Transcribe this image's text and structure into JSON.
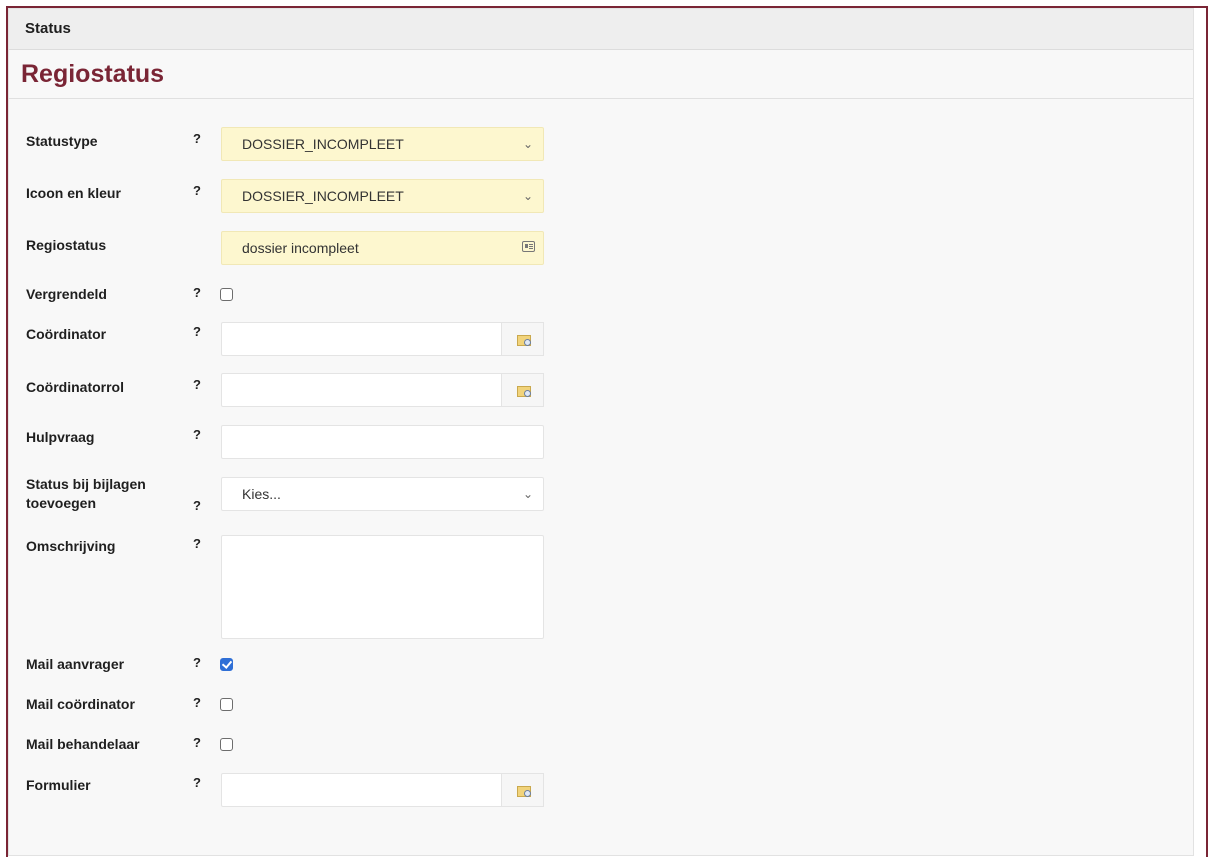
{
  "panel": {
    "header": "Status",
    "title": "Regiostatus"
  },
  "fields": {
    "statustype": {
      "label": "Statustype",
      "help": "?",
      "value": "DOSSIER_INCOMPLEET"
    },
    "icoon": {
      "label": "Icoon en kleur",
      "help": "?",
      "value": "DOSSIER_INCOMPLEET"
    },
    "regiostatus": {
      "label": "Regiostatus",
      "value": "dossier incompleet"
    },
    "vergrendeld": {
      "label": "Vergrendeld",
      "help": "?",
      "checked": false
    },
    "coordinator": {
      "label": "Coördinator",
      "help": "?",
      "value": ""
    },
    "coordinatorrol": {
      "label": "Coördinatorrol",
      "help": "?",
      "value": ""
    },
    "hulpvraag": {
      "label": "Hulpvraag",
      "help": "?",
      "value": ""
    },
    "status_bijlagen": {
      "label_line1": "Status bij bijlagen",
      "label_line2": "toevoegen",
      "help": "?",
      "value": "Kies..."
    },
    "omschrijving": {
      "label": "Omschrijving",
      "help": "?",
      "value": ""
    },
    "mail_aanvrager": {
      "label": "Mail aanvrager",
      "help": "?",
      "checked": true
    },
    "mail_coordinator": {
      "label": "Mail coördinator",
      "help": "?",
      "checked": false
    },
    "mail_behandelaar": {
      "label": "Mail behandelaar",
      "help": "?",
      "checked": false
    },
    "formulier": {
      "label": "Formulier",
      "help": "?",
      "value": ""
    }
  },
  "icons": {
    "dropdown": "chevron-down-icon",
    "card": "id-card-icon",
    "lookup": "folder-search-icon"
  },
  "colors": {
    "title": "#7a2535",
    "frame": "#7a2535",
    "highlight": "#fdf7cf",
    "checkbox_checked": "#2f6fd6"
  }
}
